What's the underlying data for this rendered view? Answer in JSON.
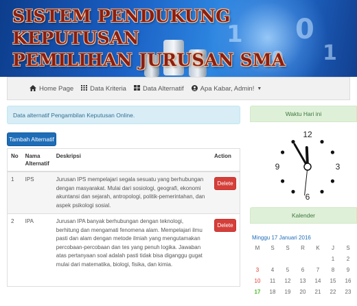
{
  "banner": {
    "title_line1": "SISTEM PENDUKUNG KEPUTUSAN",
    "title_line2": "PEMILIHAN JURUSAN SMA"
  },
  "navbar": {
    "items": [
      {
        "label": "Home Page",
        "icon": "home-icon"
      },
      {
        "label": "Data Kriteria",
        "icon": "grid-icon"
      },
      {
        "label": "Data Alternatif",
        "icon": "grid-icon"
      },
      {
        "label": "Apa Kabar, Admin!",
        "icon": "user-circle-icon",
        "dropdown": true
      }
    ]
  },
  "alert": {
    "text": "Data alternatif Pengambilan Keputusan Online."
  },
  "add_button": {
    "label": "Tambah Alternatif"
  },
  "table": {
    "headers": {
      "no": "No",
      "nama": "Nama Alternatif",
      "deskripsi": "Deskripsi",
      "action": "Action"
    },
    "rows": [
      {
        "no": "1",
        "nama": "IPS",
        "deskripsi": "Jurusan IPS mempelajari segala sesuatu yang berhubungan dengan masyarakat. Mulai dari sosiologi, geografi, ekonomi akuntansi dan sejarah, antropologi, politik-pemerintahan, dan aspek psikologi sosial.",
        "action": "Delete"
      },
      {
        "no": "2",
        "nama": "IPA",
        "deskripsi": "Jurusan IPA banyak berhubungan dengan teknologi, berhitung dan mengamati fenomena alam. Mempelajari ilmu pasti dan alam dengan metode ilmiah yang mengutamakan percobaan-percobaan dan tes yang penuh logika. Jawaban atas pertanyaan soal adalah pasti tidak bisa diganggu gugat mulai dari matematika, biologi, fisika, dan kimia.",
        "action": "Delete"
      }
    ]
  },
  "clock_panel": {
    "title": "Waktu Hari ini",
    "numbers": {
      "twelve": "12",
      "three": "3",
      "six": "6",
      "nine": "9"
    },
    "time": {
      "hour": 11,
      "minute": 55,
      "second": 31
    }
  },
  "calendar_panel": {
    "title": "Kalender",
    "date_label": "Minggu 17 Januari 2016",
    "weekdays": [
      "M",
      "S",
      "S",
      "R",
      "K",
      "J",
      "S"
    ],
    "days": [
      "",
      "",
      "",
      "",
      "",
      "1",
      "2",
      "3",
      "4",
      "5",
      "6",
      "7",
      "8",
      "9",
      "10",
      "11",
      "12",
      "13",
      "14",
      "15",
      "16",
      "17",
      "18",
      "19",
      "20",
      "21",
      "22",
      "23"
    ],
    "today": "17",
    "colors": {
      "sunday": "#e03a2e",
      "today": "#4cbb2b"
    }
  },
  "colors": {
    "primary": "#1e6db8",
    "danger": "#d43f3a",
    "info_bg": "#d9edf7",
    "success_bg": "#dff0d8",
    "title_red": "#8a1f12"
  }
}
